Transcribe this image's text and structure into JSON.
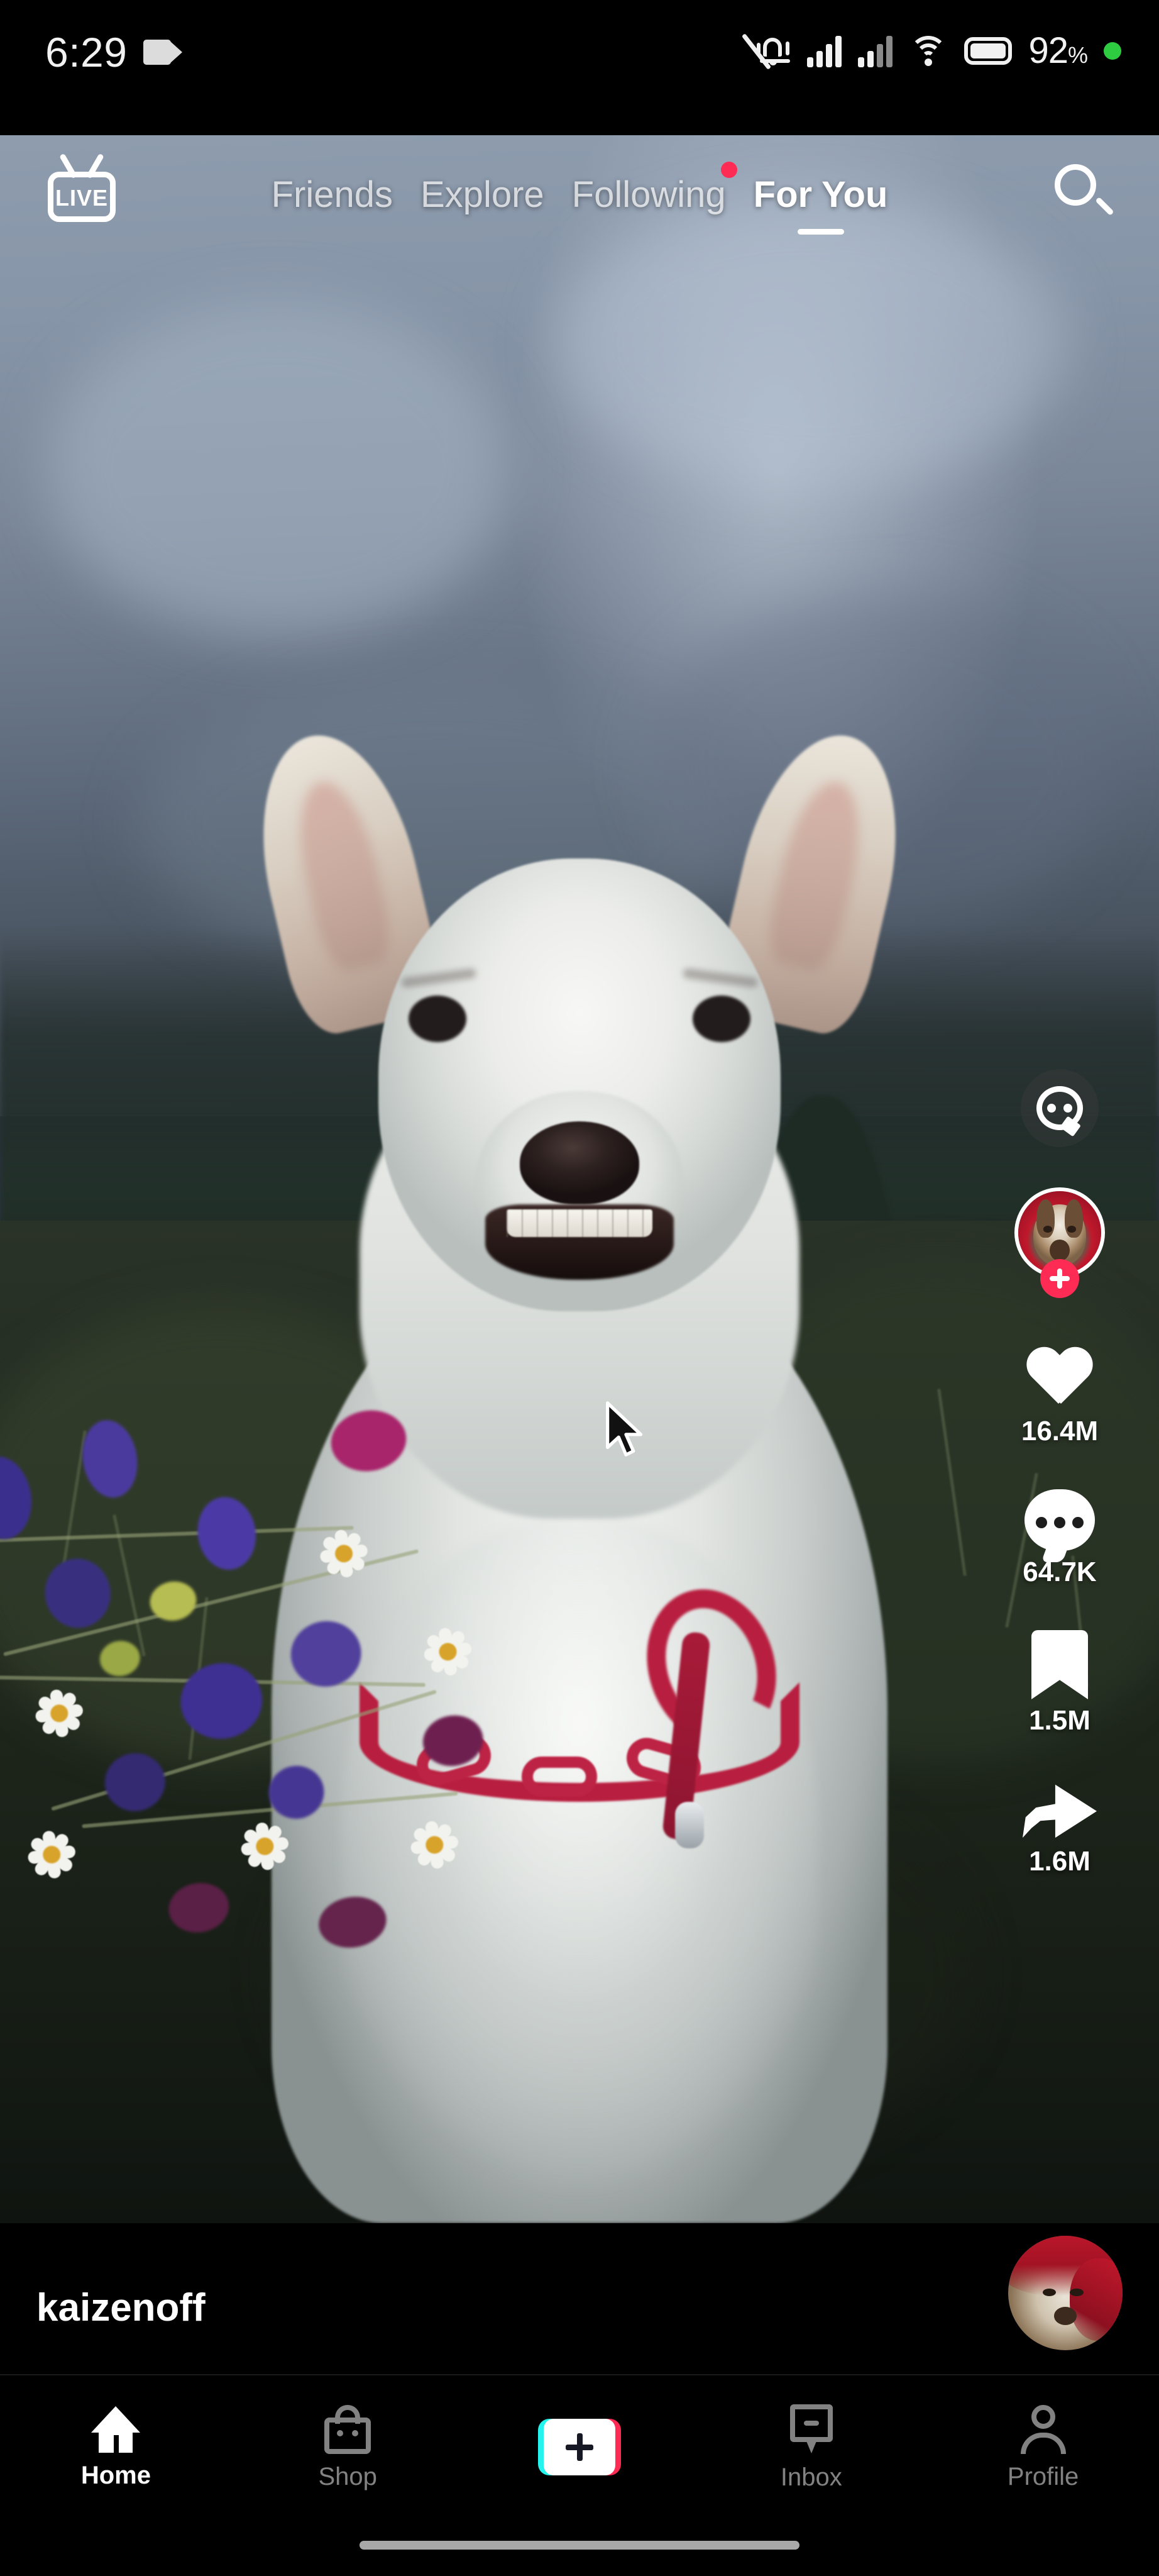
{
  "status_bar": {
    "time": "6:29",
    "camera_icon": "video-camera-icon",
    "mute_icon": "bell-mute-icon",
    "signal_icon_1": "signal-bars-full-icon",
    "signal_icon_2": "signal-bars-partial-icon",
    "wifi_icon": "wifi-icon",
    "battery_icon": "battery-icon",
    "battery_percent": "92",
    "battery_percent_symbol": "%",
    "recording_dot": "green-status-dot"
  },
  "top_nav": {
    "live_label": "LIVE",
    "live_icon": "live-tv-icon",
    "search_icon": "search-icon",
    "tabs": [
      {
        "label": "Friends",
        "active": false,
        "badge": false
      },
      {
        "label": "Explore",
        "active": false,
        "badge": false
      },
      {
        "label": "Following",
        "active": false,
        "badge": true
      },
      {
        "label": "For You",
        "active": true,
        "badge": false
      }
    ]
  },
  "video": {
    "description": "White Swiss Shepherd dog holding a bouquet of wildflowers in its mouth in a meadow at dusk",
    "sky_color": "#8e9cae",
    "field_color": "#1d251b",
    "collar_color": "#b81e3f",
    "dog_fur_color": "#f3f4f2"
  },
  "action_rail": {
    "chat_icon": "chat-bubble-icon",
    "avatar_icon": "creator-avatar",
    "follow_icon": "follow-plus-icon",
    "items": [
      {
        "icon": "heart-icon",
        "count": "16.4M"
      },
      {
        "icon": "comment-icon",
        "count": "64.7K"
      },
      {
        "icon": "bookmark-icon",
        "count": "1.5M"
      },
      {
        "icon": "share-icon",
        "count": "1.6M"
      }
    ]
  },
  "post": {
    "username": "kaizenoff",
    "music_disc_icon": "music-disc-avatar"
  },
  "bottom_nav": {
    "items": [
      {
        "label": "Home",
        "icon": "home-icon",
        "active": true
      },
      {
        "label": "Shop",
        "icon": "shop-bag-icon",
        "active": false
      },
      {
        "label": "",
        "icon": "create-plus-icon",
        "active": false
      },
      {
        "label": "Inbox",
        "icon": "inbox-icon",
        "active": false
      },
      {
        "label": "Profile",
        "icon": "profile-icon",
        "active": false
      }
    ]
  },
  "system": {
    "home_indicator": "home-indicator-bar",
    "cursor": "mouse-pointer"
  },
  "colors": {
    "accent_pink": "#fe2c55",
    "accent_cyan": "#25f4ee",
    "active_text": "#ffffff",
    "inactive_text": "#828282",
    "background": "#000000",
    "battery_green": "#2ecc40"
  }
}
